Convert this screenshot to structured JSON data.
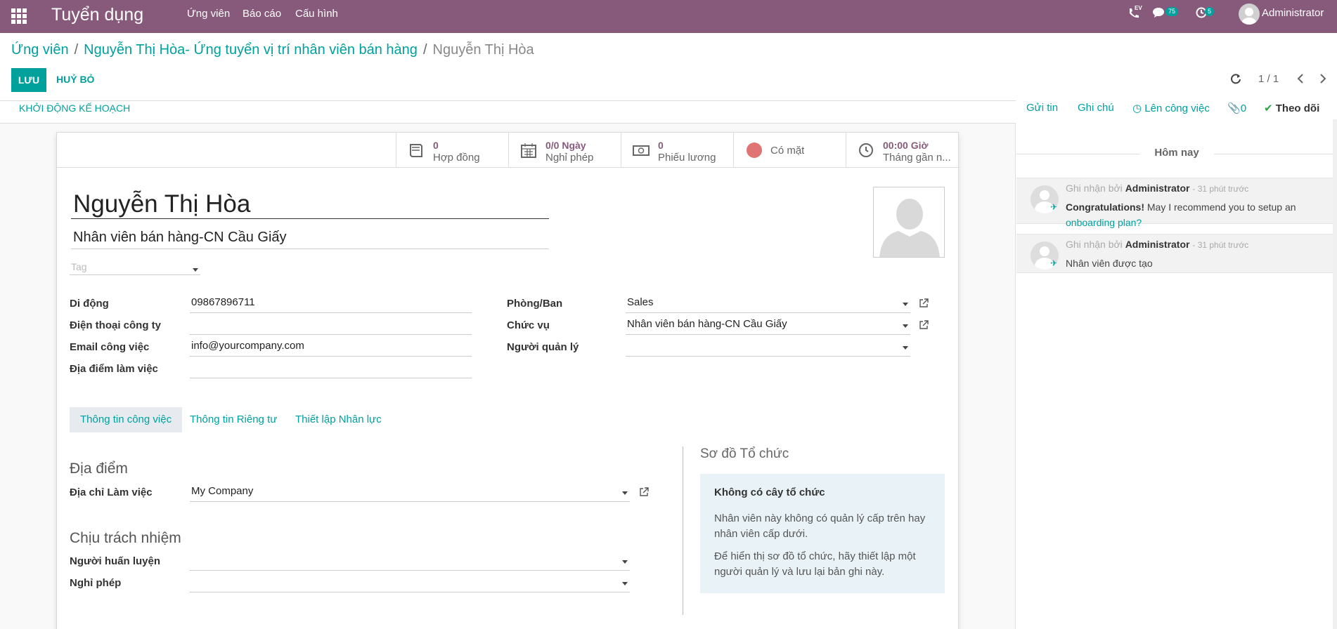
{
  "navbar": {
    "brand": "Tuyển dụng",
    "menu": [
      "Ứng viên",
      "Báo cáo",
      "Cấu hình"
    ],
    "ev_label": "EV",
    "messages_count": "75",
    "activities_count": "5",
    "user": "Administrator"
  },
  "breadcrumb": {
    "items": [
      "Ứng viên",
      "Nguyễn Thị Hòa- Ứng tuyển vị trí nhân viên bán hàng"
    ],
    "current": "Nguyễn Thị Hòa"
  },
  "buttons": {
    "save": "LƯU",
    "discard": "HUỶ BỎ"
  },
  "pager": {
    "value": "1 / 1"
  },
  "statusbar": {
    "action": "KHỞI ĐỘNG KẾ HOẠCH"
  },
  "smart_buttons": [
    {
      "value": "0",
      "label": "Hợp đồng",
      "icon": "book-icon"
    },
    {
      "value": "0/0 Ngày",
      "label": "Nghỉ phép",
      "icon": "calendar-icon"
    },
    {
      "value": "0",
      "label": "Phiếu lương",
      "icon": "money-icon"
    },
    {
      "value": "",
      "label": "Có mặt",
      "icon": "presence-dot-icon"
    },
    {
      "value": "00:00 Giờ",
      "label": "Tháng gần n...",
      "icon": "clock-icon"
    }
  ],
  "employee": {
    "name": "Nguyễn Thị Hòa",
    "job_title": "Nhân viên bán hàng-CN Cầu Giấy",
    "tag_placeholder": "Tag"
  },
  "fields_left": [
    {
      "label": "Di động",
      "value": "09867896711"
    },
    {
      "label": "Điện thoại công ty",
      "value": ""
    },
    {
      "label": "Email công việc",
      "value": "info@yourcompany.com"
    },
    {
      "label": "Địa điểm làm việc",
      "value": ""
    }
  ],
  "fields_right": [
    {
      "label": "Phòng/Ban",
      "value": "Sales"
    },
    {
      "label": "Chức vụ",
      "value": "Nhân viên bán hàng-CN Cầu Giấy"
    },
    {
      "label": "Người quản lý",
      "value": ""
    }
  ],
  "tabs": [
    "Thông tin công việc",
    "Thông tin Riêng tư",
    "Thiết lập Nhân lực"
  ],
  "location_section": {
    "title": "Địa điểm",
    "work_address_label": "Địa chỉ Làm việc",
    "work_address_value": "My Company"
  },
  "responsible_section": {
    "title": "Chịu trách nhiệm",
    "coach_label": "Người huấn luyện",
    "coach_value": "",
    "leave_label": "Nghỉ phép",
    "leave_value": ""
  },
  "org_chart": {
    "title": "Sơ đồ Tổ chức",
    "heading": "Không có cây tổ chức",
    "p1": "Nhân viên này không có quản lý cấp trên hay nhân viên cấp dưới.",
    "p2": "Để hiển thị sơ đồ tổ chức, hãy thiết lập một người quản lý và lưu lại bản ghi này."
  },
  "chatter": {
    "send_message": "Gửi tin",
    "log_note": "Ghi chú",
    "schedule": "Lên công việc",
    "attachments": "0",
    "follow": "Theo dõi",
    "today": "Hôm nay",
    "messages": [
      {
        "prefix": "Ghi nhận bởi",
        "author": "Administrator",
        "time": "- 31 phút trước",
        "bold": "Congratulations!",
        "text": " May I recommend you to setup an ",
        "link": "onboarding plan?"
      },
      {
        "prefix": "Ghi nhận bởi",
        "author": "Administrator",
        "time": "- 31 phút trước",
        "text": "Nhân viên được tạo"
      }
    ]
  },
  "colors": {
    "brand": "#875a7b",
    "accent": "#00a09d"
  }
}
